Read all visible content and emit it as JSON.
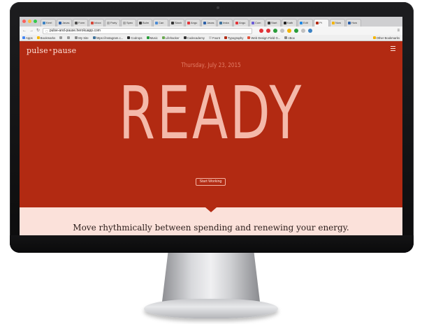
{
  "browser": {
    "tabs": [
      {
        "label": "Kerri",
        "color": "#3b82c4"
      },
      {
        "label": "Javas",
        "color": "#2b5fa8"
      },
      {
        "label": "Form",
        "color": "#4c4c4c"
      },
      {
        "label": "Inbox",
        "color": "#d44638"
      },
      {
        "label": "Party",
        "color": "#aaaaaa"
      },
      {
        "label": "Spec",
        "color": "#aaaaaa"
      },
      {
        "label": "Bulm",
        "color": "#333333"
      },
      {
        "label": "Can",
        "color": "#4a8ad4"
      },
      {
        "label": "Slash",
        "color": "#333333"
      },
      {
        "label": "Angu",
        "color": "#e23237"
      },
      {
        "label": "Javas",
        "color": "#2b5fa8"
      },
      {
        "label": "Insta",
        "color": "#3f729b"
      },
      {
        "label": "Angu",
        "color": "#e23237"
      },
      {
        "label": "Com",
        "color": "#6b5bd6"
      },
      {
        "label": "Start",
        "color": "#333333"
      },
      {
        "label": "Kath",
        "color": "#222222"
      },
      {
        "label": "Edit",
        "color": "#1e88e5"
      },
      {
        "label": "Pt",
        "color": "#b22a12",
        "active": true
      },
      {
        "label": "Now",
        "color": "#f4b400"
      },
      {
        "label": "How",
        "color": "#2b5fa8"
      }
    ],
    "omnibox_text": "pulse-and-pause.herokuapp.com",
    "extension_colors": [
      "#e23237",
      "#e23237",
      "#2a9d3a",
      "#c0c0c0",
      "#f4b400",
      "#2a9d3a",
      "#c0c0c0",
      "#3b82c4"
    ],
    "bookmarks": [
      {
        "label": "Apps",
        "color": "#4285f4"
      },
      {
        "label": "Bookmarks",
        "color": "#f4b400"
      },
      {
        "label": "",
        "color": "#999999"
      },
      {
        "label": "",
        "color": "#999999"
      },
      {
        "label": "My Site",
        "color": "#888888"
      },
      {
        "label": "https://instagram.c...",
        "color": "#3f729b"
      },
      {
        "label": "Codrops",
        "color": "#2b2b2b"
      },
      {
        "label": "Music",
        "color": "#2a9d3a"
      },
      {
        "label": "Lifehacker",
        "color": "#6aa84f"
      },
      {
        "label": "Codecademy",
        "color": "#333333"
      },
      {
        "label": "Fount",
        "color": "#cccccc"
      },
      {
        "label": "Typography",
        "color": "#b22a12"
      },
      {
        "label": "Web Design Field G...",
        "color": "#e0533b"
      },
      {
        "label": "cBox",
        "color": "#888888"
      }
    ],
    "other_bookmarks": "Other Bookmarks"
  },
  "page": {
    "brand_left": "pulse",
    "brand_dot": "•",
    "brand_right": "pause",
    "date": "Thursday, July 23, 2015",
    "headline": "READY",
    "start_button": "Start Working",
    "tagline": "Move rhythmically between spending and renewing your energy."
  },
  "colors": {
    "hero_bg": "#b22a12",
    "headline": "#f4b9aa",
    "lower_bg": "#fbe1da"
  }
}
